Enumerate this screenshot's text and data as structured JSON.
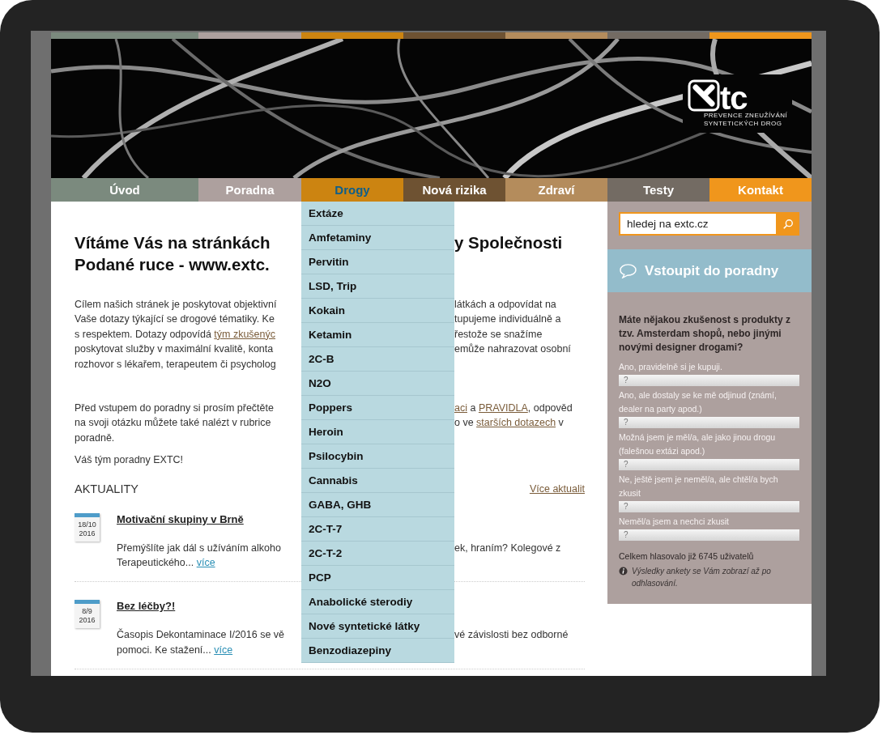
{
  "header": {
    "logo": {
      "wordmark": "tc",
      "tagline": [
        "PREVENCE ZNEUŽÍVÁNÍ",
        "SYNTETICKÝCH DROG"
      ]
    }
  },
  "nav": [
    {
      "label": "Úvod",
      "color": "#7b8a7e",
      "selected": false
    },
    {
      "label": "Poradna",
      "color": "#ada09e",
      "selected": false
    },
    {
      "label": "Drogy",
      "color": "#cc8411",
      "selected": true,
      "menu": [
        "Extáze",
        "Amfetaminy",
        "Pervitin",
        "LSD, Trip",
        "Kokain",
        "Ketamin",
        "2C-B",
        "N2O",
        "Poppers",
        "Heroin",
        "Psilocybin",
        "Cannabis",
        "GABA, GHB",
        "2C-T-7",
        "2C-T-2",
        "PCP",
        "Anabolické sterodiy",
        "Nové syntetické látky",
        "Benzodiazepiny"
      ]
    },
    {
      "label": "Nová rizika",
      "color": "#6e5232",
      "selected": false
    },
    {
      "label": "Zdraví",
      "color": "#b48c5c",
      "selected": false
    },
    {
      "label": "Testy",
      "color": "#736b63",
      "selected": false
    },
    {
      "label": "Kontakt",
      "color": "#f0961c",
      "selected": false
    }
  ],
  "content": {
    "heading": [
      {
        "left": [
          {
            "kind": "text",
            "text": "Vítáme Vás na stránkách"
          }
        ],
        "right": [
          {
            "kind": "text",
            "text": "y Společnosti"
          }
        ]
      },
      {
        "left": [
          {
            "kind": "text",
            "text": "Podané ruce - www.extc."
          }
        ]
      }
    ],
    "paragraphs": [
      [
        {
          "left": [
            {
              "kind": "text",
              "text": "Cílem našich stránek je poskytovat objektivní"
            }
          ],
          "right": [
            {
              "kind": "text",
              "text": "látkách a odpovídat na"
            }
          ]
        },
        {
          "left": [
            {
              "kind": "text",
              "text": "Vaše dotazy týkající se drogové tématiky. Ke"
            }
          ],
          "right": [
            {
              "kind": "text",
              "text": "tupujeme individuálně a"
            }
          ]
        },
        {
          "left": [
            {
              "kind": "text",
              "text": "s respektem. Dotazy odpovídá "
            },
            {
              "kind": "link",
              "text": "tým zkušenýc"
            }
          ],
          "right": [
            {
              "kind": "text",
              "text": "řestože se snažíme"
            }
          ]
        },
        {
          "left": [
            {
              "kind": "text",
              "text": "poskytovat služby v maximální kvalitě, konta"
            }
          ],
          "right": [
            {
              "kind": "text",
              "text": "emůže nahrazovat osobní"
            }
          ]
        },
        {
          "left": [
            {
              "kind": "text",
              "text": "rozhovor s lékařem, terapeutem či psycholog"
            }
          ]
        }
      ],
      [
        {
          "left": [
            {
              "kind": "text",
              "text": "Před vstupem do poradny si prosím přečtěte"
            }
          ],
          "right": [
            {
              "kind": "link",
              "text": "aci"
            },
            {
              "kind": "text",
              "text": " a "
            },
            {
              "kind": "link",
              "text": "PRAVIDLA"
            },
            {
              "kind": "text",
              "text": ", odpověd"
            }
          ]
        },
        {
          "left": [
            {
              "kind": "text",
              "text": "na svoji otázku můžete také nalézt v rubrice"
            }
          ],
          "right": [
            {
              "kind": "text",
              "text": "o ve "
            },
            {
              "kind": "link",
              "text": "starších dotazech"
            },
            {
              "kind": "text",
              "text": " v"
            }
          ]
        },
        {
          "left": [
            {
              "kind": "text",
              "text": "poradně."
            }
          ]
        }
      ],
      [
        {
          "left": [
            {
              "kind": "text",
              "text": "Váš tým poradny EXTC!"
            }
          ]
        }
      ]
    ],
    "news_title": "AKTUALITY",
    "news_more": "Více aktualit",
    "news": [
      {
        "day": "18/10",
        "year": "2016",
        "title": "Motivační skupiny v Brně",
        "lines": [
          {
            "left": [
              {
                "kind": "text",
                "text": "Přemýšlíte jak dál s užíváním alkoho"
              }
            ],
            "right": [
              {
                "kind": "text",
                "text": "ek, hraním? Kolegové z"
              }
            ]
          },
          {
            "left": [
              {
                "kind": "text",
                "text": "Terapeutického... "
              },
              {
                "kind": "more",
                "text": "více"
              }
            ]
          }
        ]
      },
      {
        "day": "8/9",
        "year": "2016",
        "title": "Bez léčby?!",
        "lines": [
          {
            "left": [
              {
                "kind": "text",
                "text": "Časopis Dekontaminace I/2016 se vě"
              }
            ],
            "right": [
              {
                "kind": "text",
                "text": "vé závislosti bez odborné"
              }
            ]
          },
          {
            "left": [
              {
                "kind": "text",
                "text": "pomoci. Ke stažení... "
              },
              {
                "kind": "more",
                "text": "více"
              }
            ]
          }
        ]
      }
    ]
  },
  "sidebar": {
    "search": {
      "value": "hledej na extc.cz"
    },
    "enter_button": "Vstoupit do poradny",
    "poll": {
      "question": "Máte nějakou zkušenost s produkty z tzv. Amsterdam shopů, nebo jinými novými designer drogami?",
      "options": [
        {
          "label": "Ano, pravidelně si je kupuji.",
          "bar": "?"
        },
        {
          "label": "Ano, ale dostaly se ke mě odjinud (známí, dealer na party apod.)",
          "bar": "?"
        },
        {
          "label": "Možná jsem je měl/a, ale jako jinou drogu (falešnou extázi apod.)",
          "bar": "?"
        },
        {
          "label": "Ne, ještě jsem je neměl/a, ale chtěl/a bych zkusit",
          "bar": "?"
        },
        {
          "label": "Neměl/a jsem a nechci zkusit",
          "bar": "?"
        }
      ],
      "total": "Celkem hlasovalo již 6745 uživatelů",
      "note": "Výsledky ankety se Vám zobrazí až po odhlasování."
    }
  }
}
